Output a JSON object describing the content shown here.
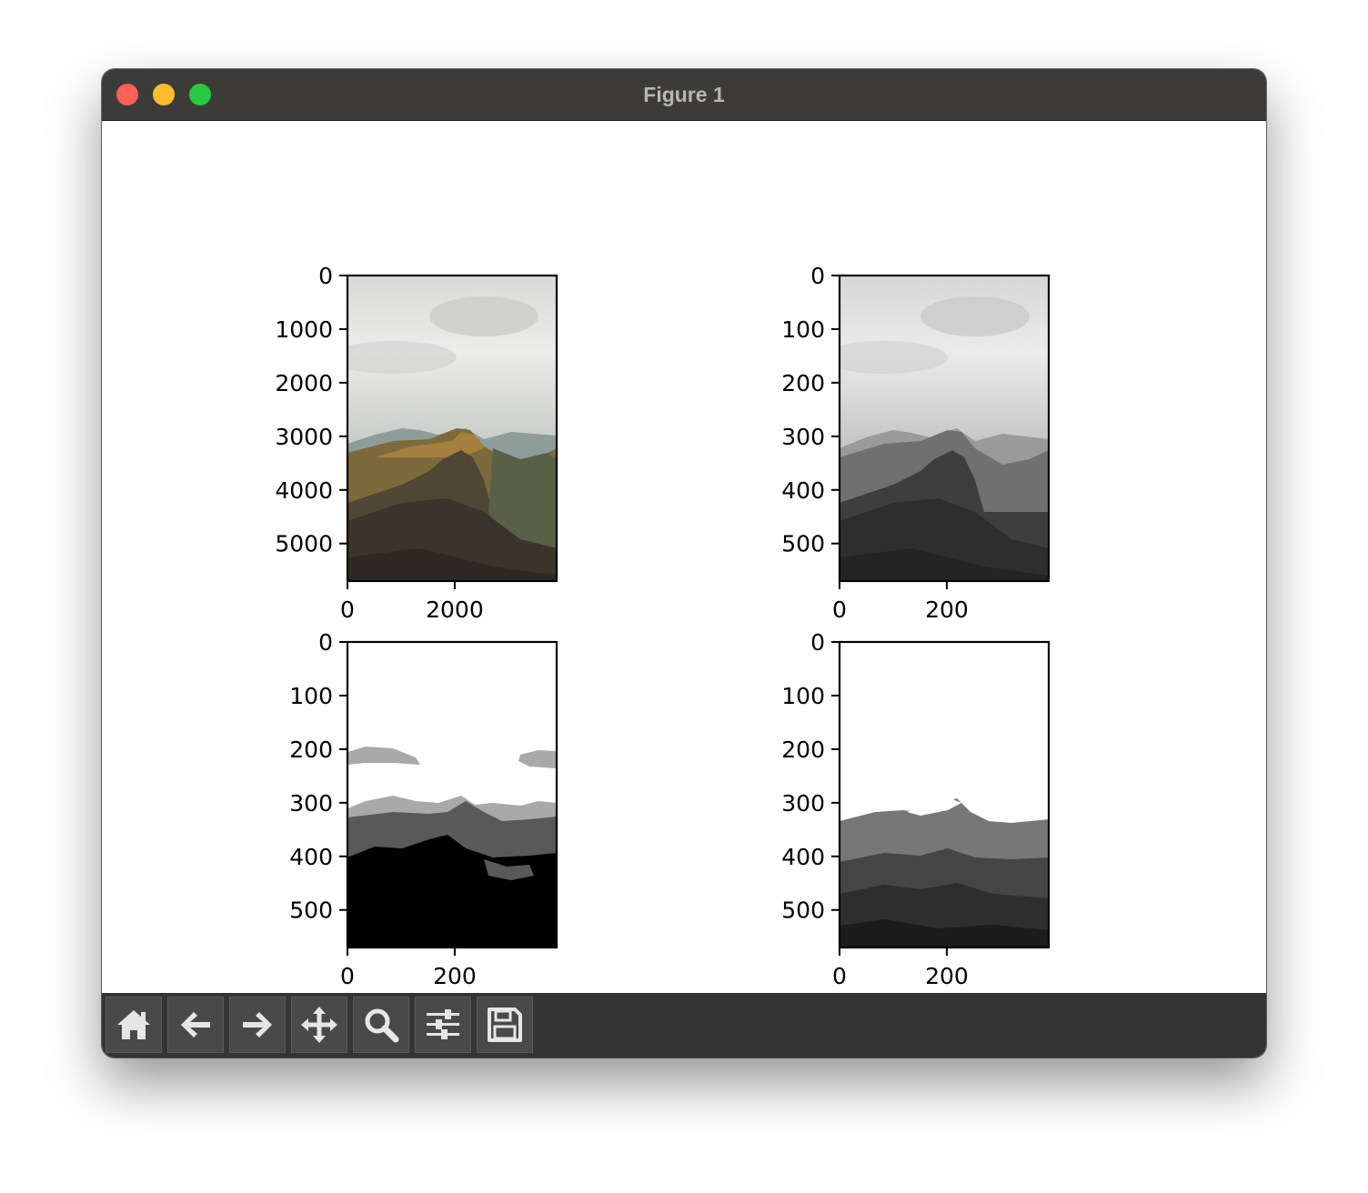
{
  "window": {
    "title": "Figure 1"
  },
  "toolbar": {
    "buttons": [
      {
        "name": "home",
        "icon": "home-icon"
      },
      {
        "name": "back",
        "icon": "arrow-left-icon"
      },
      {
        "name": "forward",
        "icon": "arrow-right-icon"
      },
      {
        "name": "pan",
        "icon": "move-icon"
      },
      {
        "name": "zoom",
        "icon": "magnifier-icon"
      },
      {
        "name": "configure-subplots",
        "icon": "sliders-icon"
      },
      {
        "name": "save",
        "icon": "floppy-disk-icon"
      }
    ]
  },
  "colors": {
    "titlebar": "#3c3b39",
    "toolbar": "#343434",
    "button": "#494949",
    "icon": "#e6e6e6"
  },
  "chart_data": [
    {
      "type": "image",
      "content": "color mountain photo",
      "xlim": [
        0,
        3900
      ],
      "ylim": [
        5700,
        0
      ],
      "xticks": [
        "0",
        "2000"
      ],
      "yticks": [
        "0",
        "1000",
        "2000",
        "3000",
        "4000",
        "5000"
      ]
    },
    {
      "type": "image",
      "content": "grayscale mountain photo",
      "xlim": [
        0,
        390
      ],
      "ylim": [
        570,
        0
      ],
      "xticks": [
        "0",
        "200"
      ],
      "yticks": [
        "0",
        "100",
        "200",
        "300",
        "400",
        "500"
      ]
    },
    {
      "type": "image",
      "content": "posterized grayscale (3 levels)",
      "xlim": [
        0,
        390
      ],
      "ylim": [
        570,
        0
      ],
      "xticks": [
        "0",
        "200"
      ],
      "yticks": [
        "0",
        "100",
        "200",
        "300",
        "400",
        "500"
      ]
    },
    {
      "type": "image",
      "content": "posterized grayscale with white sky",
      "xlim": [
        0,
        390
      ],
      "ylim": [
        570,
        0
      ],
      "xticks": [
        "0",
        "200"
      ],
      "yticks": [
        "0",
        "100",
        "200",
        "300",
        "400",
        "500"
      ]
    }
  ]
}
